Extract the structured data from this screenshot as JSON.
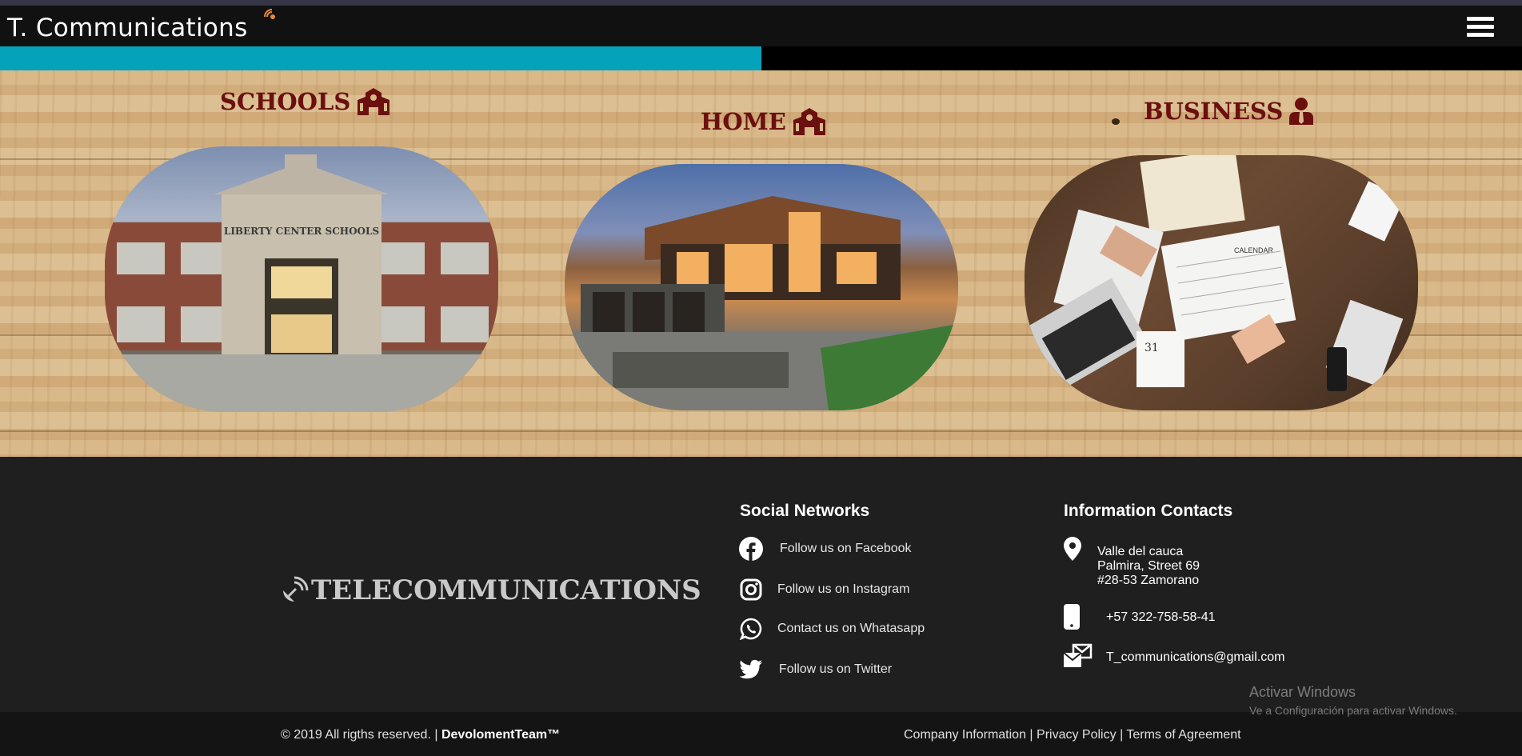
{
  "navbar": {
    "brand": "T. Communications",
    "menu_icon": "hamburger-menu-icon",
    "brand_icon": "satellite-dish-icon"
  },
  "progress": {
    "value_percent": 50,
    "fill_color": "#05a2bc"
  },
  "categories": [
    {
      "title": "SCHOOLS",
      "icon": "school-icon",
      "image": "school-building-photo",
      "sign_text": "LIBERTY CENTER SCHOOLS"
    },
    {
      "title": "HOME",
      "icon": "school-icon",
      "image": "modern-house-photo"
    },
    {
      "title": "BUSINESS",
      "icon": "user-tie-icon",
      "image": "business-desk-photo",
      "calendar_text": "CALENDAR",
      "day_text": "31"
    }
  ],
  "footer": {
    "logo_text": "TELECOMMUNICATIONS",
    "social": {
      "heading": "Social Networks",
      "items": [
        {
          "label": "Follow us on Facebook",
          "icon": "facebook-icon"
        },
        {
          "label": "Follow us on Instagram",
          "icon": "instagram-icon"
        },
        {
          "label": "Contact us on Whatasapp",
          "icon": "whatsapp-icon"
        },
        {
          "label": "Follow us on Twitter",
          "icon": "twitter-icon"
        }
      ]
    },
    "contacts": {
      "heading": "Information Contacts",
      "address_line1": "Valle del cauca",
      "address_line2": "Palmira, Street 69",
      "address_line3": "#28-53 Zamorano",
      "phone": "+57 322-758-58-41",
      "email": "T_communications@gmail.com"
    }
  },
  "bottom": {
    "copyright": "© 2019 All rigths reserved. |",
    "team": "DevolomentTeam™",
    "link_company": "Company Information",
    "link_privacy": "Privacy Policy",
    "link_terms": "Terms of Agreement",
    "separator": "|"
  },
  "watermark": {
    "line1": "Activar Windows",
    "line2": "Ve a Configuración para activar Windows."
  },
  "colors": {
    "accent": "#05a2bc",
    "title_red": "#6b0f0f",
    "footer_bg": "#1f1f1f",
    "nav_bg": "#111111"
  }
}
